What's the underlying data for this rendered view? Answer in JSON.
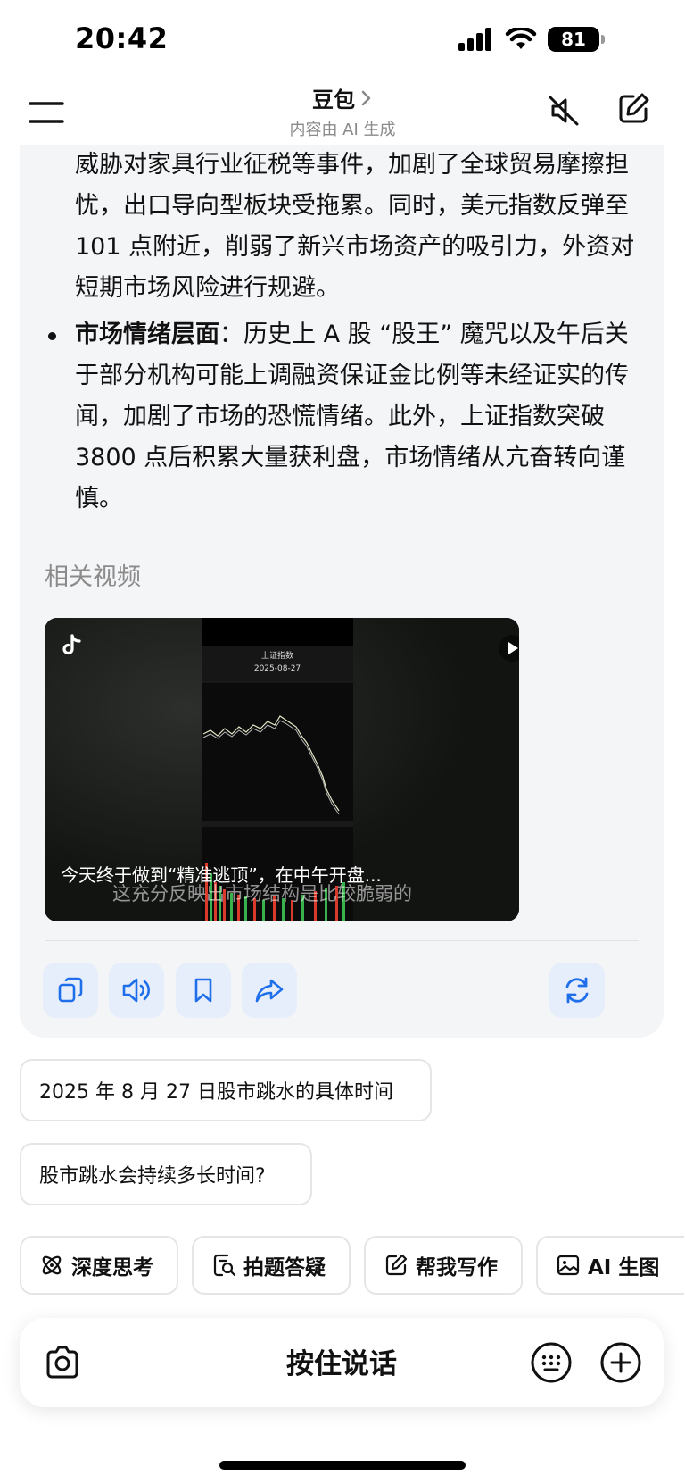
{
  "status": {
    "time": "20:42",
    "battery": "81"
  },
  "header": {
    "title": "豆包",
    "subtitle": "内容由 AI 生成"
  },
  "message": {
    "paragraph1": "威胁对家具行业征税等事件，加剧了全球贸易摩擦担忧，出口导向型板块受拖累。同时，美元指数反弹至 101 点附近，削弱了新兴市场资产的吸引力，外资对短期市场风险进行规避。",
    "bullet_label": "市场情绪层面",
    "bullet_text": "：历史上 A 股 “股王” 魔咒以及午后关于部分机构可能上调融资保证金比例等未经证实的传闻，加剧了市场的恐慌情绪。此外，上证指数突破 3800 点后积累大量获利盘，市场情绪从亢奋转向谨慎。"
  },
  "related": {
    "label": "相关视频",
    "video": {
      "title": "今天终于做到“精准逃顶”，在中午开盘...",
      "subtitle": "这充分反映出市场结构是比较脆弱的",
      "screen_title": "上证指数",
      "screen_date": "2025-08-27"
    }
  },
  "actions": {
    "copy": "copy-icon",
    "speak": "speaker-icon",
    "bookmark": "bookmark-icon",
    "share": "share-icon",
    "regenerate": "refresh-icon"
  },
  "suggestions": [
    "2025 年 8 月 27 日股市跳水的具体时间",
    "股市跳水会持续多长时间?"
  ],
  "chips": [
    "深度思考",
    "拍题答疑",
    "帮我写作",
    "AI 生图"
  ],
  "input": {
    "talk_label": "按住说话"
  },
  "colors": {
    "accent": "#1f6feb",
    "action_bg": "#e6eefb",
    "card_bg": "#f4f5f7"
  }
}
